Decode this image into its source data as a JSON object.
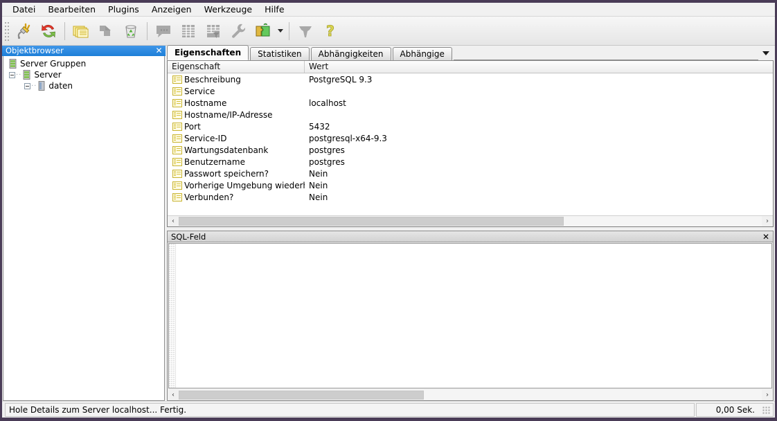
{
  "window": {
    "border_color": "#4a3c57"
  },
  "menubar": {
    "items": [
      {
        "label": "Datei",
        "name": "menu-datei"
      },
      {
        "label": "Bearbeiten",
        "name": "menu-bearbeiten"
      },
      {
        "label": "Plugins",
        "name": "menu-plugins"
      },
      {
        "label": "Anzeigen",
        "name": "menu-anzeigen"
      },
      {
        "label": "Werkzeuge",
        "name": "menu-werkzeuge"
      },
      {
        "label": "Hilfe",
        "name": "menu-hilfe"
      }
    ]
  },
  "toolbar": {
    "buttons": [
      {
        "icon": "plug-connect-icon",
        "enabled": true
      },
      {
        "icon": "refresh-icon",
        "enabled": true
      },
      {
        "icon": "separator"
      },
      {
        "icon": "properties-folders-icon",
        "enabled": true
      },
      {
        "icon": "drop-arrow-icon",
        "enabled": false
      },
      {
        "icon": "trash-recycle-icon",
        "enabled": true
      },
      {
        "icon": "separator"
      },
      {
        "icon": "sql-bubble-icon",
        "enabled": false
      },
      {
        "icon": "grid-view-icon",
        "enabled": false
      },
      {
        "icon": "grid-filter-icon",
        "enabled": false
      },
      {
        "icon": "wrench-icon",
        "enabled": false
      },
      {
        "icon": "puzzle-plugins-icon",
        "enabled": true
      },
      {
        "icon": "dropdown-caret-icon",
        "enabled": true
      },
      {
        "icon": "separator"
      },
      {
        "icon": "shield-drop-icon",
        "enabled": false
      },
      {
        "icon": "help-question-icon",
        "enabled": true
      }
    ]
  },
  "objectbrowser": {
    "title": "Objektbrowser",
    "close_label": "✕",
    "tree": [
      {
        "label": "Server Gruppen",
        "icon": "server-group-icon",
        "level": 0,
        "expander": false
      },
      {
        "label": "Server",
        "icon": "server-icon",
        "level": 1,
        "expander": true
      },
      {
        "label": "daten",
        "icon": "database-icon",
        "level": 2,
        "expander": true
      }
    ]
  },
  "tabs": [
    {
      "label": "Eigenschaften",
      "active": true
    },
    {
      "label": "Statistiken",
      "active": false
    },
    {
      "label": "Abhängigkeiten",
      "active": false
    },
    {
      "label": "Abhängige",
      "active": false
    }
  ],
  "property_grid": {
    "columns": [
      "Eigenschaft",
      "Wert"
    ],
    "rows": [
      {
        "property": "Beschreibung",
        "value": "PostgreSQL 9.3"
      },
      {
        "property": "Service",
        "value": ""
      },
      {
        "property": "Hostname",
        "value": "localhost"
      },
      {
        "property": "Hostname/IP-Adresse",
        "value": ""
      },
      {
        "property": "Port",
        "value": "5432"
      },
      {
        "property": "Service-ID",
        "value": "postgresql-x64-9.3"
      },
      {
        "property": "Wartungsdatenbank",
        "value": "postgres"
      },
      {
        "property": "Benutzername",
        "value": "postgres"
      },
      {
        "property": "Passwort speichern?",
        "value": "Nein"
      },
      {
        "property": "Vorherige Umgebung wiederhers…",
        "value": "Nein"
      },
      {
        "property": "Verbunden?",
        "value": "Nein"
      }
    ],
    "scroll_left_arrow": "‹",
    "scroll_right_arrow": "›"
  },
  "sql_panel": {
    "title": "SQL-Feld",
    "close_label": "✕",
    "content": "",
    "scroll_left_arrow": "‹",
    "scroll_right_arrow": "›"
  },
  "statusbar": {
    "message": "Hole Details zum Server localhost... Fertig.",
    "duration": "0,00 Sek."
  }
}
